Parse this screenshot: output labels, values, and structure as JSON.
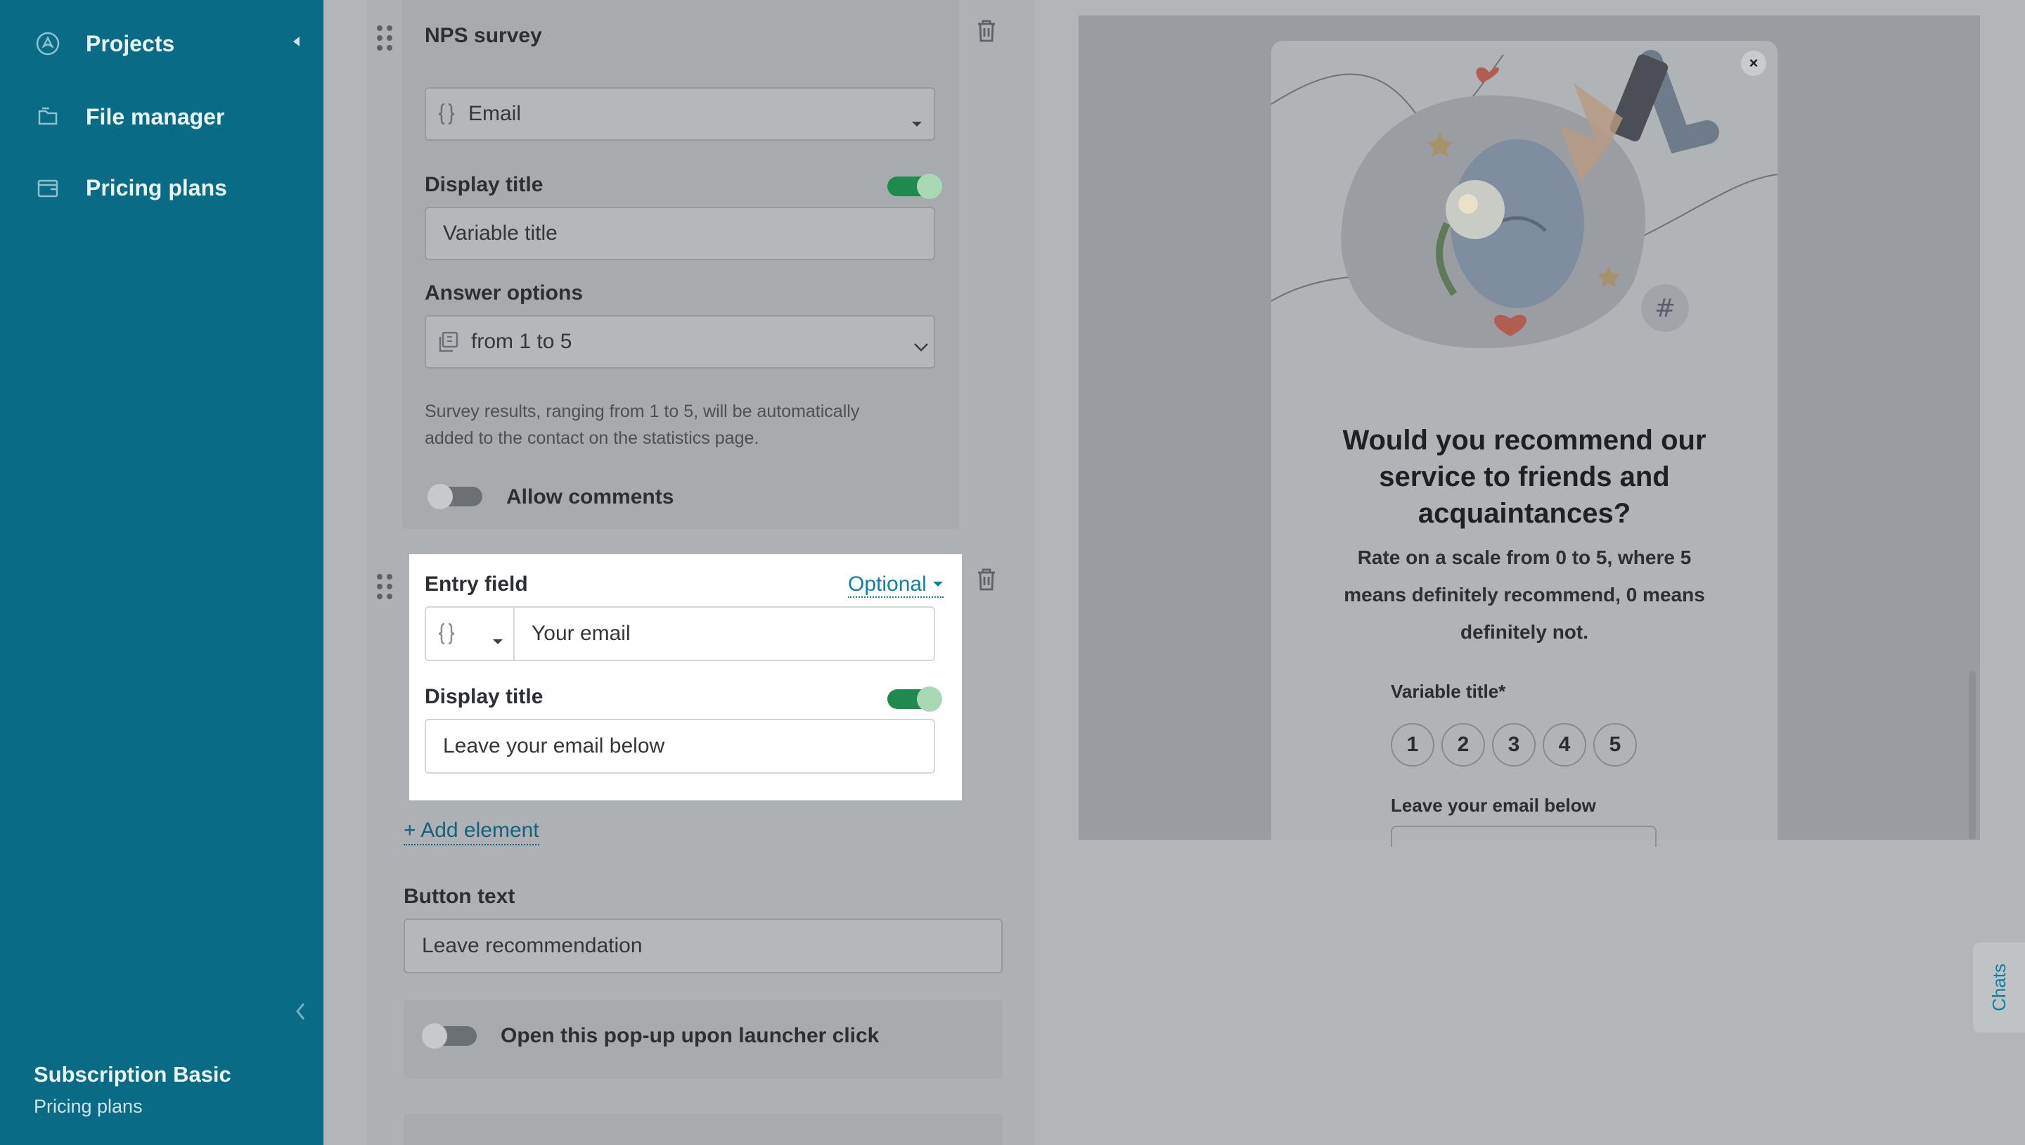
{
  "sidebar": {
    "items": [
      {
        "label": "Projects",
        "icon": "rocket-icon"
      },
      {
        "label": "File manager",
        "icon": "folder-icon"
      },
      {
        "label": "Pricing plans",
        "icon": "wallet-icon"
      }
    ],
    "subscription": {
      "plan": "Subscription Basic",
      "link": "Pricing plans"
    }
  },
  "editor": {
    "nps": {
      "title": "NPS survey",
      "variable_value": "Email",
      "display_title_label": "Display title",
      "display_title_on": true,
      "display_title_value": "Variable title",
      "answer_options_label": "Answer options",
      "answer_options_value": "from 1 to 5",
      "help_text_line1": "Survey results, ranging from 1 to 5, will be automatically",
      "help_text_line2": "added to the contact on the statistics page.",
      "allow_comments_label": "Allow comments",
      "allow_comments_on": false
    },
    "entry": {
      "title": "Entry field",
      "optional_label": "Optional",
      "field_value": "Your email",
      "display_title_label": "Display title",
      "display_title_on": true,
      "display_title_value": "Leave your email below"
    },
    "add_element": "+ Add element",
    "button_text_label": "Button text",
    "button_text_value": "Leave recommendation",
    "open_popup_label": "Open this pop-up upon launcher click",
    "open_popup_on": false
  },
  "preview": {
    "question_line1": "Would you recommend our",
    "question_line2": "service to friends and",
    "question_line3": "acquaintances?",
    "subtitle_line1": "Rate on a scale from 0 to 5, where 5",
    "subtitle_line2": "means definitely recommend, 0 means",
    "subtitle_line3": "definitely not.",
    "rating_label": "Variable title*",
    "ratings": [
      "1",
      "2",
      "3",
      "4",
      "5"
    ],
    "email_label": "Leave your email below",
    "close": "×"
  },
  "chats_label": "Chats",
  "colors": {
    "sidebar": "#096b86",
    "accent": "#0e82a6",
    "toggle_on": "#1f8a4d"
  }
}
